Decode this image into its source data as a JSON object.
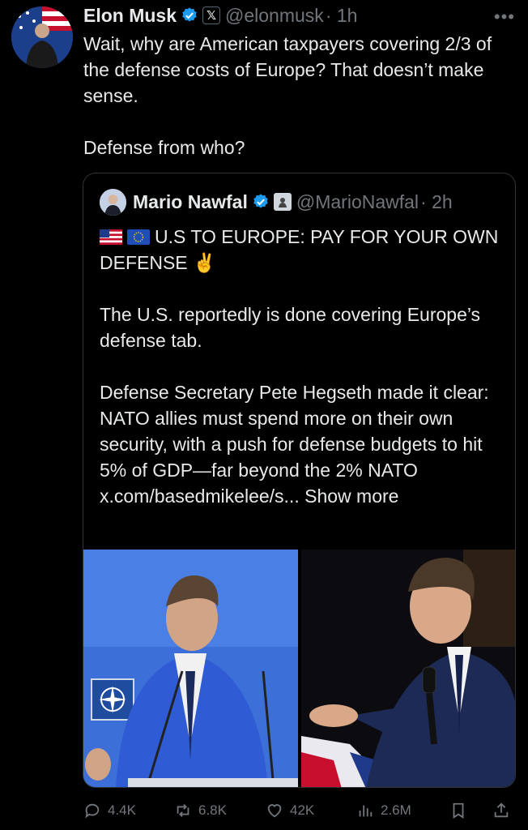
{
  "tweet": {
    "author_name": "Elon Musk",
    "x_badge": "𝕏",
    "handle": "@elonmusk",
    "time": "· 1h",
    "paragraphs": [
      "Wait, why are American taxpayers covering 2/3 of the defense costs of Europe? That doesn’t make sense.",
      "Defense from who?"
    ]
  },
  "quote": {
    "author_name": "Mario Nawfal",
    "handle": "@MarioNawfal",
    "time": "· 2h",
    "headline": "U.S TO EUROPE: PAY FOR YOUR OWN DEFENSE ✌️",
    "paragraph2": "The U.S. reportedly is done covering Europe’s defense tab.",
    "paragraph3": "Defense Secretary Pete Hegseth made it clear: NATO allies must spend more on their own security, with a push for defense budgets to hit 5% of GDP—far beyond the 2% NATO x.com/basedmikelee/s...",
    "show_more": "Show more"
  },
  "actions": {
    "replies": "4.4K",
    "reposts": "6.8K",
    "likes": "42K",
    "views": "2.6M"
  },
  "colors": {
    "background": "#000000",
    "text": "#e7e9ea",
    "muted": "#71767b",
    "border": "#2f3336",
    "verified": "#1d9bf0"
  }
}
